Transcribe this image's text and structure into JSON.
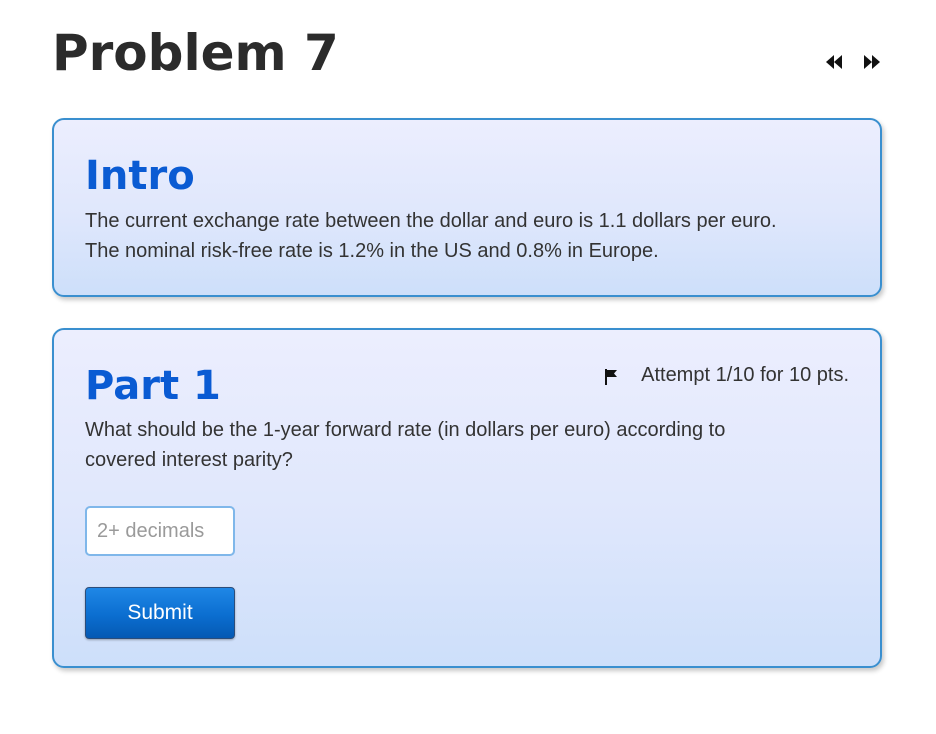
{
  "header": {
    "title": "Problem 7",
    "nav_prev_icon": "rewind-icon",
    "nav_next_icon": "fast-forward-icon"
  },
  "intro": {
    "heading": "Intro",
    "line1": "The current exchange rate between the dollar and euro is 1.1 dollars per euro.",
    "line2": "The nominal risk-free rate is 1.2% in the US and 0.8% in Europe."
  },
  "part1": {
    "heading": "Part 1",
    "attempt_text": "Attempt 1/10 for 10 pts.",
    "flag_icon": "flag-icon",
    "question_line1": "What should be the 1-year forward rate (in dollars per euro) according to",
    "question_line2": "covered interest parity?",
    "input_placeholder": "2+ decimals",
    "input_value": "",
    "submit_label": "Submit"
  },
  "colors": {
    "heading_blue": "#0a5bd3",
    "card_border": "#3a8fcf",
    "submit_blue": "#0b6ed0",
    "title_dark": "#2b2b2b"
  }
}
